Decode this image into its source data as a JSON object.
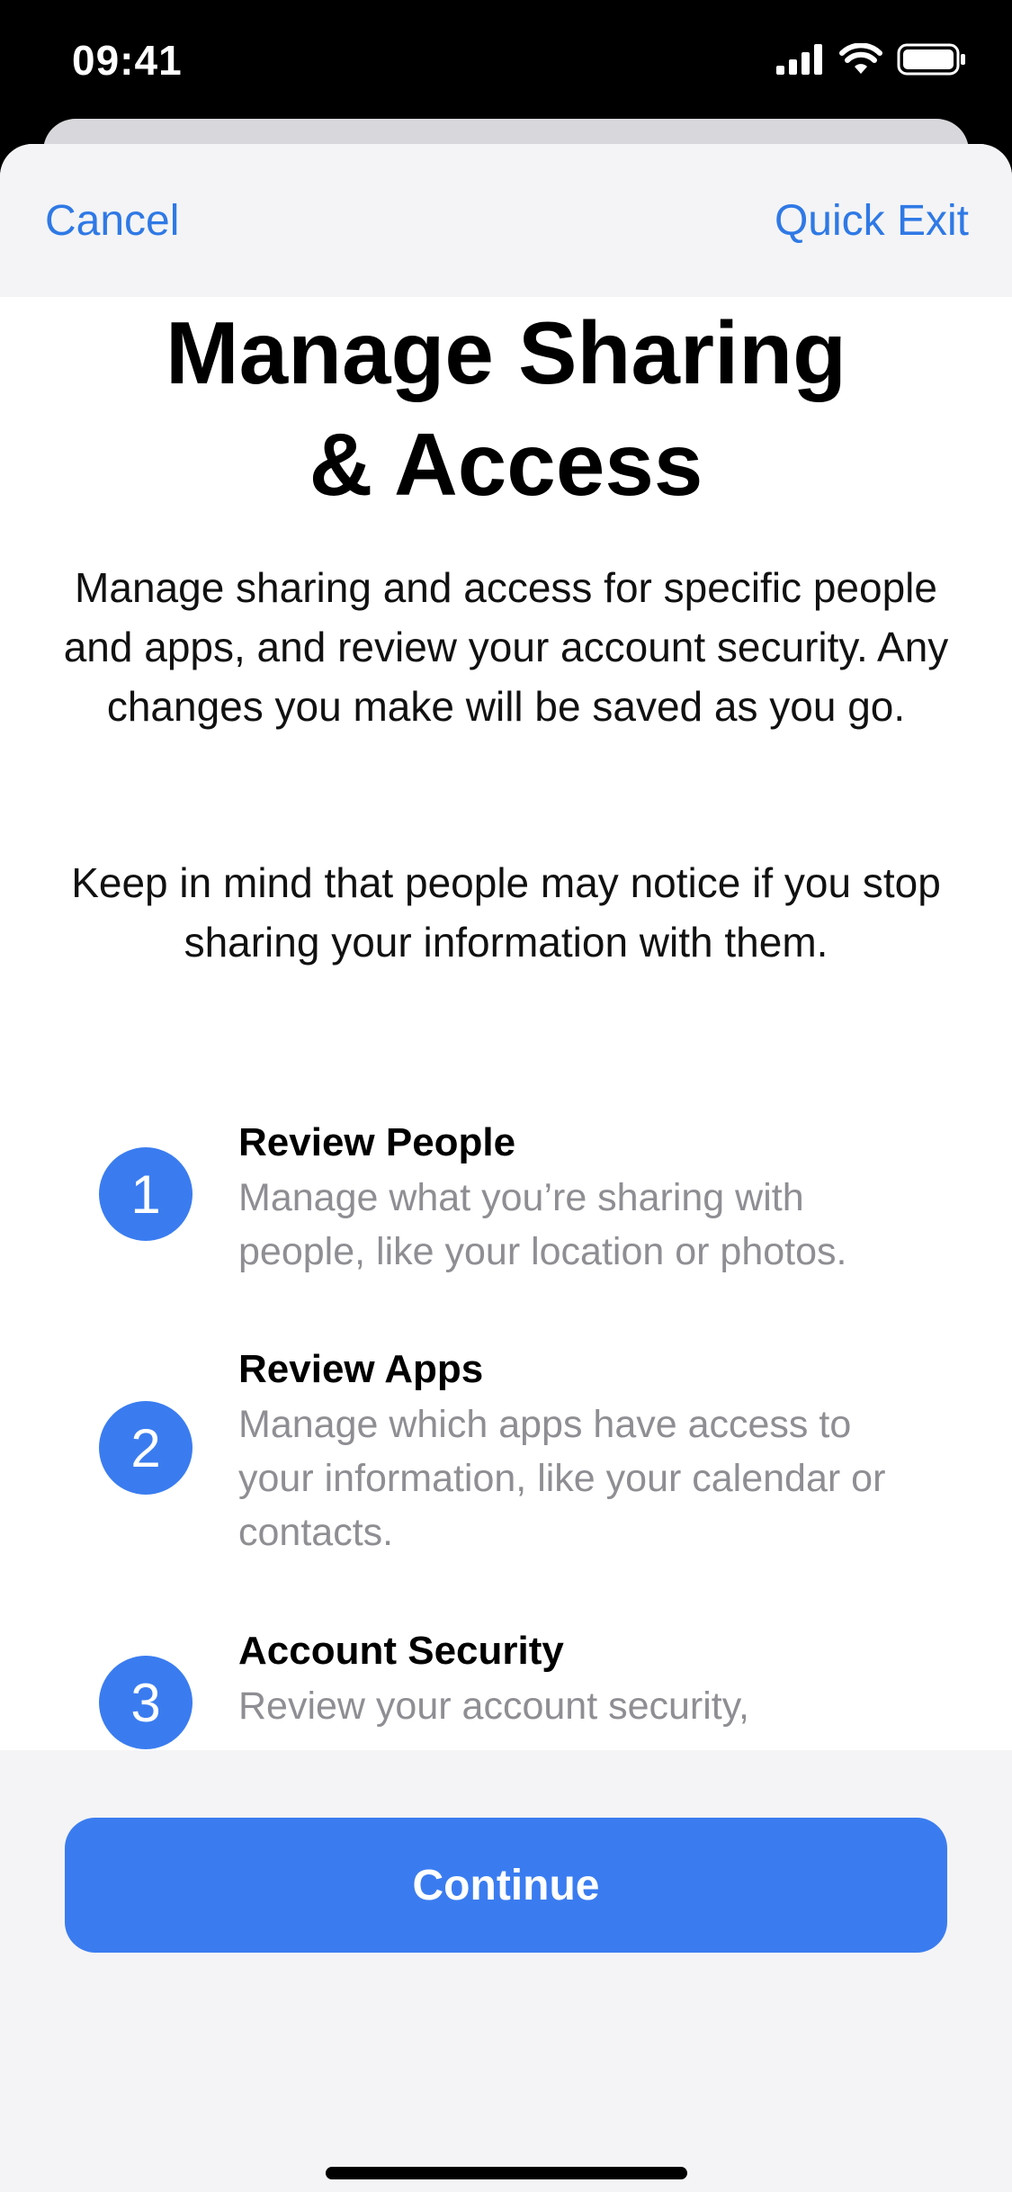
{
  "status": {
    "time": "09:41",
    "icons": [
      "cellular-signal-icon",
      "wifi-icon",
      "battery-icon"
    ]
  },
  "nav": {
    "cancel_label": "Cancel",
    "quick_exit_label": "Quick Exit"
  },
  "title": {
    "line1": "Manage Sharing",
    "line2": "& Access"
  },
  "intro": {
    "paragraph1": "Manage sharing and access for specific people and apps, and review your account security. Any changes you make will be saved as you go.",
    "paragraph2": "Keep in mind that people may notice if you stop sharing your information with them."
  },
  "steps": [
    {
      "number": "1",
      "title": "Review People",
      "description": "Manage what you’re sharing with people, like your location or photos."
    },
    {
      "number": "2",
      "title": "Review Apps",
      "description": "Manage which apps have access to your information, like your calendar or contacts."
    },
    {
      "number": "3",
      "title": "Account Security",
      "description": "Review your account security,"
    }
  ],
  "footer": {
    "continue_label": "Continue"
  },
  "colors": {
    "accent": "#3a7cf0",
    "link": "#2f79e6",
    "secondary_text": "#8e8e93",
    "bar_background": "#f4f4f6"
  }
}
